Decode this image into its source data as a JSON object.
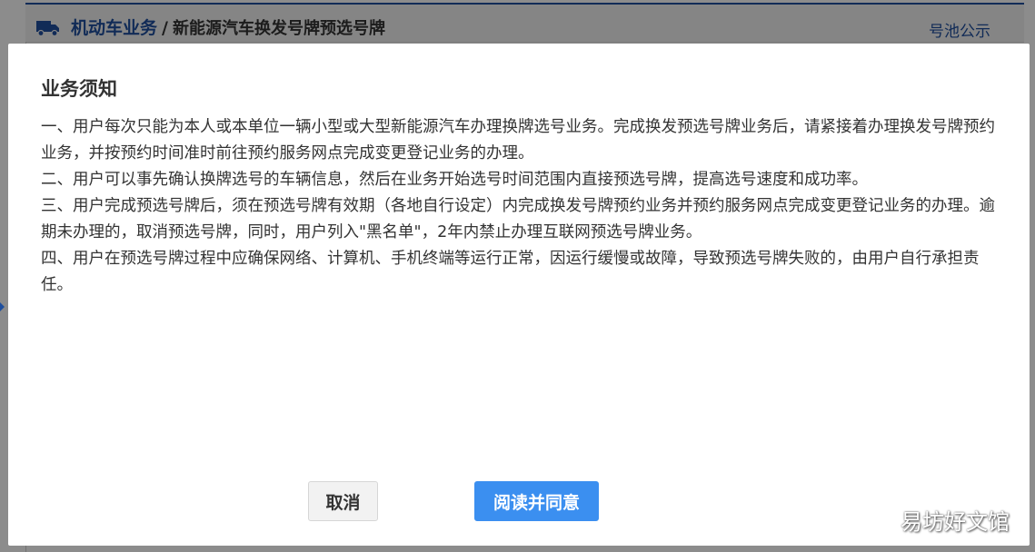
{
  "header": {
    "breadcrumb_root": "机动车业务",
    "breadcrumb_separator": "/",
    "breadcrumb_current": "新能源汽车换发号牌预选号牌",
    "pool_link": "号池公示",
    "truck_icon": "truck-icon"
  },
  "modal": {
    "title": "业务须知",
    "paragraphs": [
      "一、用户每次只能为本人或本单位一辆小型或大型新能源汽车办理换牌选号业务。完成换发预选号牌业务后，请紧接着办理换发号牌预约业务，并按预约时间准时前往预约服务网点完成变更登记业务的办理。",
      "二、用户可以事先确认换牌选号的车辆信息，然后在业务开始选号时间范围内直接预选号牌，提高选号速度和成功率。",
      "三、用户完成预选号牌后，须在预选号牌有效期（各地自行设定）内完成换发号牌预约业务并预约服务网点完成变更登记业务的办理。逾期未办理的，取消预选号牌，同时，用户列入\"黑名单\"，2年内禁止办理互联网预选号牌业务。",
      "四、用户在预选号牌过程中应确保网络、计算机、手机终端等运行正常，因运行缓慢或故障，导致预选号牌失败的，由用户自行承担责任。"
    ],
    "cancel_label": "取消",
    "agree_label": "阅读并同意"
  },
  "watermark": "易坊好文馆",
  "colors": {
    "brand_blue": "#1f4f9e",
    "primary_button": "#3b8ff0"
  }
}
